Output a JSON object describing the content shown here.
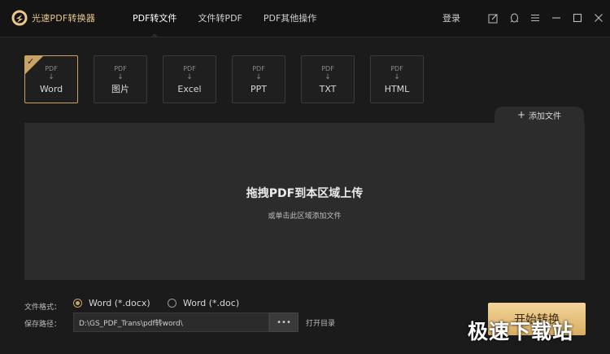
{
  "app": {
    "title": "光速PDF转换器"
  },
  "nav": {
    "tabs": [
      {
        "label": "PDF转文件"
      },
      {
        "label": "文件转PDF"
      },
      {
        "label": "PDF其他操作"
      }
    ],
    "active_index": 0
  },
  "header": {
    "login_label": "登录"
  },
  "window_controls": {
    "icons": [
      "edit-icon",
      "qq-icon",
      "menu-icon",
      "minimize-icon",
      "maximize-icon",
      "close-icon"
    ]
  },
  "formats": {
    "source_label": "PDF",
    "arrow": "↓",
    "items": [
      {
        "label": "Word"
      },
      {
        "label": "图片"
      },
      {
        "label": "Excel"
      },
      {
        "label": "PPT"
      },
      {
        "label": "TXT"
      },
      {
        "label": "HTML"
      }
    ],
    "selected_index": 0
  },
  "add_file": {
    "plus": "+",
    "label": "添加文件"
  },
  "dropzone": {
    "title": "拖拽PDF到本区域上传",
    "subtitle": "或单击此区域添加文件"
  },
  "options": {
    "format_label": "文件格式：",
    "format_options": [
      {
        "label": "Word (*.docx)"
      },
      {
        "label": "Word (*.doc)"
      }
    ],
    "format_selected": 0,
    "save_label": "保存路径：",
    "save_path": "D:\\GS_PDF_Trans\\pdf转word\\",
    "browse_label": "•••",
    "open_dir_label": "打开目录",
    "start_label": "开始转换"
  },
  "watermark": {
    "text": "极速下载站"
  },
  "colors": {
    "accent": "#c8a367",
    "background": "#1b1b1b",
    "panel": "#2c2c2c",
    "button": "#e3bc77"
  }
}
